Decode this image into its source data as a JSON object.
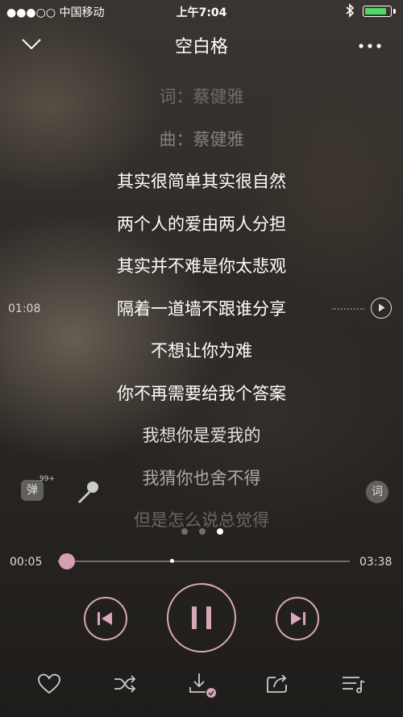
{
  "status_bar": {
    "carrier": "●●●○○ 中国移动",
    "time": "上午7:04",
    "bluetooth_icon": "bluetooth-icon",
    "battery_level": 0.9,
    "battery_color": "#4cd964"
  },
  "header": {
    "title": "空白格",
    "collapse_icon": "chevron-down-icon",
    "more_icon": "more-icon"
  },
  "lyrics": {
    "current_time_marker": "01:08",
    "lines": [
      {
        "text": "词：蔡健雅",
        "opacity": 0.28
      },
      {
        "text": "曲：蔡健雅",
        "opacity": 0.38
      },
      {
        "text": "其实很简单其实很自然",
        "opacity": 1
      },
      {
        "text": "两个人的爱由两人分担",
        "opacity": 1
      },
      {
        "text": "其实并不难是你太悲观",
        "opacity": 1
      },
      {
        "text": "隔着一道墙不跟谁分享",
        "opacity": 1
      },
      {
        "text": "不想让你为难",
        "opacity": 1
      },
      {
        "text": "你不再需要给我个答案",
        "opacity": 1
      },
      {
        "text": "我想你是爱我的",
        "opacity": 0.85
      },
      {
        "text": "我猜你也舍不得",
        "opacity": 0.6
      },
      {
        "text": "但是怎么说总觉得",
        "opacity": 0.3
      }
    ]
  },
  "tools": {
    "danmu_label": "弹",
    "danmu_count": "99+",
    "lyrics_button_label": "词"
  },
  "page_indicator": {
    "count": 3,
    "active": 2
  },
  "progress": {
    "elapsed": "00:05",
    "duration": "03:38",
    "played_fraction": 0.03,
    "buffer_fraction": 0.39
  },
  "accent_color": "#d6a8b8",
  "controls": {
    "prev_icon": "previous-icon",
    "pause_icon": "pause-icon",
    "next_icon": "next-icon"
  },
  "bottom_bar": [
    "heart-icon",
    "shuffle-icon",
    "download-icon",
    "share-icon",
    "playlist-icon"
  ]
}
